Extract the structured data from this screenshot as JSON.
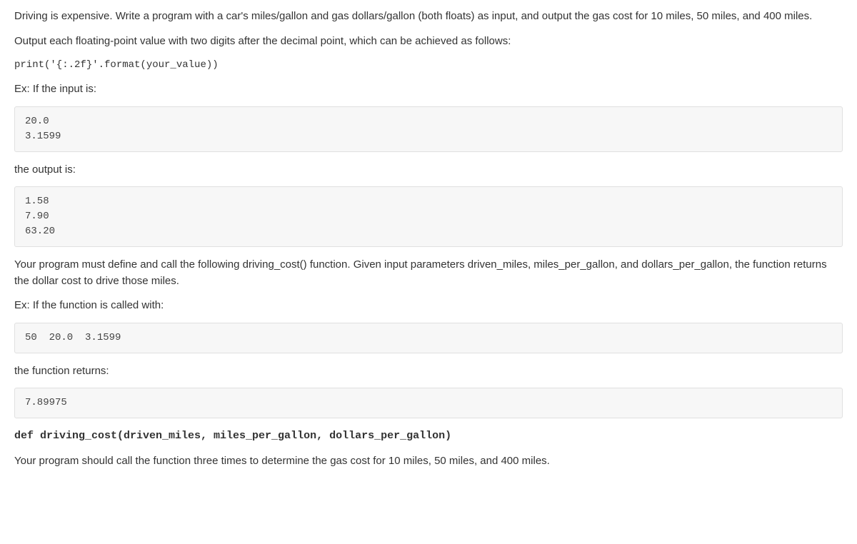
{
  "intro1": "Driving is expensive. Write a program with a car's miles/gallon and gas dollars/gallon (both floats) as input, and output the gas cost for 10 miles, 50 miles, and 400 miles.",
  "intro2": "Output each floating-point value with two digits after the decimal point, which can be achieved as follows:",
  "print_example": "print('{:.2f}'.format(your_value))",
  "ex_input_label": "Ex: If the input is:",
  "input_block": "20.0\n3.1599",
  "output_label": "the output is:",
  "output_block": "1.58\n7.90\n63.20",
  "define_text": "Your program must define and call the following driving_cost() function. Given input parameters driven_miles, miles_per_gallon, and dollars_per_gallon, the function returns the dollar cost to drive those miles.",
  "ex_func_label": "Ex: If the function is called with:",
  "func_args_block": "50  20.0  3.1599",
  "func_returns_label": "the function returns:",
  "func_return_block": "7.89975",
  "def_signature": "def driving_cost(driven_miles, miles_per_gallon, dollars_per_gallon)",
  "final_text": "Your program should call the function three times to determine the gas cost for 10 miles, 50 miles, and 400 miles."
}
